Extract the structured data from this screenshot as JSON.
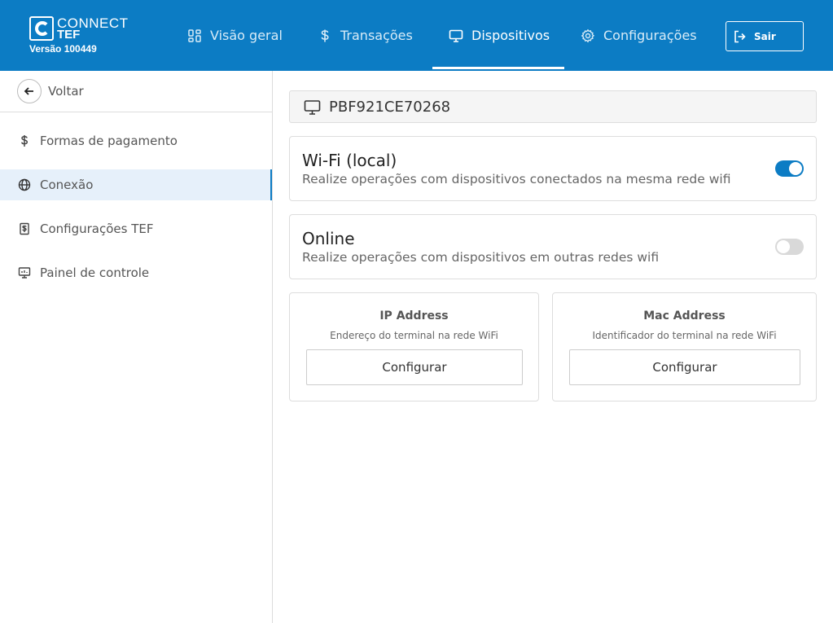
{
  "brand": {
    "line1": "CONNECT",
    "line2": "TEF",
    "version": "Versão 100449"
  },
  "nav": {
    "tabs": [
      {
        "label": "Visão geral",
        "icon": "overview-icon"
      },
      {
        "label": "Transações",
        "icon": "dollar-icon"
      },
      {
        "label": "Dispositivos",
        "icon": "monitor-icon",
        "active": true
      },
      {
        "label": "Configurações",
        "icon": "gear-icon"
      }
    ],
    "logout_label": "Sair"
  },
  "sidebar": {
    "back_label": "Voltar",
    "items": [
      {
        "label": "Formas de pagamento",
        "icon": "dollar-icon"
      },
      {
        "label": "Conexão",
        "icon": "globe-icon",
        "active": true
      },
      {
        "label": "Configurações TEF",
        "icon": "receipt-icon"
      },
      {
        "label": "Painel de controle",
        "icon": "dashboard-icon"
      }
    ]
  },
  "device": {
    "serial": "PBF921CE70268"
  },
  "connections": [
    {
      "title": "Wi-Fi (local)",
      "description": "Realize operações com dispositivos conectados na mesma rede wifi",
      "enabled": true
    },
    {
      "title": "Online",
      "description": "Realize operações com dispositivos em outras redes wifi",
      "enabled": false
    }
  ],
  "addresses": [
    {
      "title": "IP Address",
      "subtitle": "Endereço do terminal na rede WiFi",
      "button": "Configurar"
    },
    {
      "title": "Mac Address",
      "subtitle": "Identificador do terminal na rede WiFi",
      "button": "Configurar"
    }
  ],
  "colors": {
    "primary": "#0c7cc4",
    "active_bg": "#e6f0fa"
  }
}
